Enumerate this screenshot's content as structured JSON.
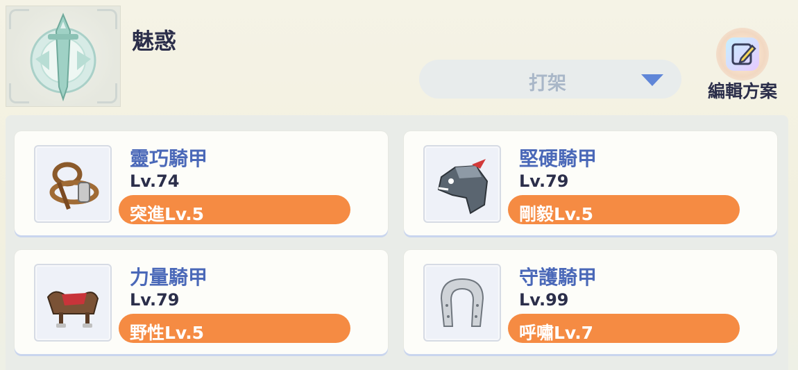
{
  "header": {
    "title": "魅惑"
  },
  "emblem": {
    "icon": "sword-crest-icon"
  },
  "preset": {
    "value": "打架"
  },
  "edit": {
    "label": "編輯方案",
    "icon": "edit-pencil-icon"
  },
  "colors": {
    "accent": "#f58b43",
    "name_blue": "#4a68b8"
  },
  "armors": [
    {
      "name": "靈巧騎甲",
      "level": "Lv.74",
      "skill": "突進Lv.5",
      "icon": "bridle-icon"
    },
    {
      "name": "堅硬騎甲",
      "level": "Lv.79",
      "skill": "剛毅Lv.5",
      "icon": "horse-helmet-icon"
    },
    {
      "name": "力量騎甲",
      "level": "Lv.79",
      "skill": "野性Lv.5",
      "icon": "saddle-icon"
    },
    {
      "name": "守護騎甲",
      "level": "Lv.99",
      "skill": "呼嘯Lv.7",
      "icon": "horseshoe-icon"
    }
  ]
}
